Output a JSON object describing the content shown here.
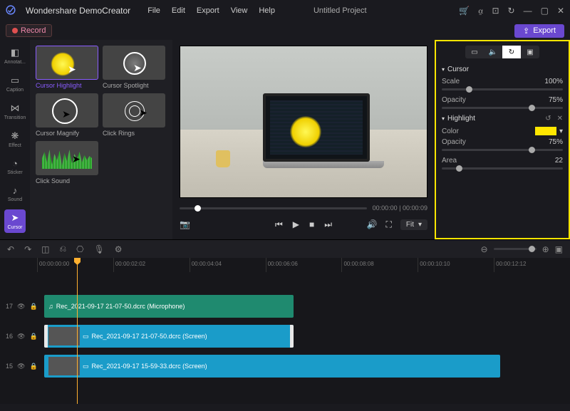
{
  "app": {
    "name": "Wondershare DemoCreator",
    "project": "Untitled Project"
  },
  "menu": [
    "File",
    "Edit",
    "Export",
    "View",
    "Help"
  ],
  "toolbar": {
    "record": "Record",
    "export": "Export"
  },
  "sidebar": [
    {
      "label": "Annotat..."
    },
    {
      "label": "Caption"
    },
    {
      "label": "Transition"
    },
    {
      "label": "Effect"
    },
    {
      "label": "Sticker"
    },
    {
      "label": "Sound"
    },
    {
      "label": "Cursor"
    }
  ],
  "library": [
    {
      "label": "Cursor Highlight"
    },
    {
      "label": "Cursor Spotlight"
    },
    {
      "label": "Cursor Magnify"
    },
    {
      "label": "Click Rings"
    },
    {
      "label": "Click Sound"
    }
  ],
  "preview": {
    "time": "00:00:00 | 00:00:09",
    "fit": "Fit"
  },
  "props": {
    "cursor_header": "Cursor",
    "scale_label": "Scale",
    "scale_value": "100%",
    "opacity_label": "Opacity",
    "opacity_value": "75%",
    "highlight_header": "Highlight",
    "color_label": "Color",
    "color_value": "#ffe600",
    "hopacity_label": "Opacity",
    "hopacity_value": "75%",
    "area_label": "Area",
    "area_value": "22"
  },
  "ruler": [
    "00:00:00:00",
    "00:00:02:02",
    "00:00:04:04",
    "00:00:06:06",
    "00:00:08:08",
    "00:00:10:10",
    "00:00:12:12"
  ],
  "tracks": [
    {
      "num": "17",
      "clip": "Rec_2021-09-17 21-07-50.dcrc (Microphone)"
    },
    {
      "num": "16",
      "clip": "Rec_2021-09-17 21-07-50.dcrc (Screen)"
    },
    {
      "num": "15",
      "clip": "Rec_2021-09-17 15-59-33.dcrc (Screen)"
    }
  ]
}
